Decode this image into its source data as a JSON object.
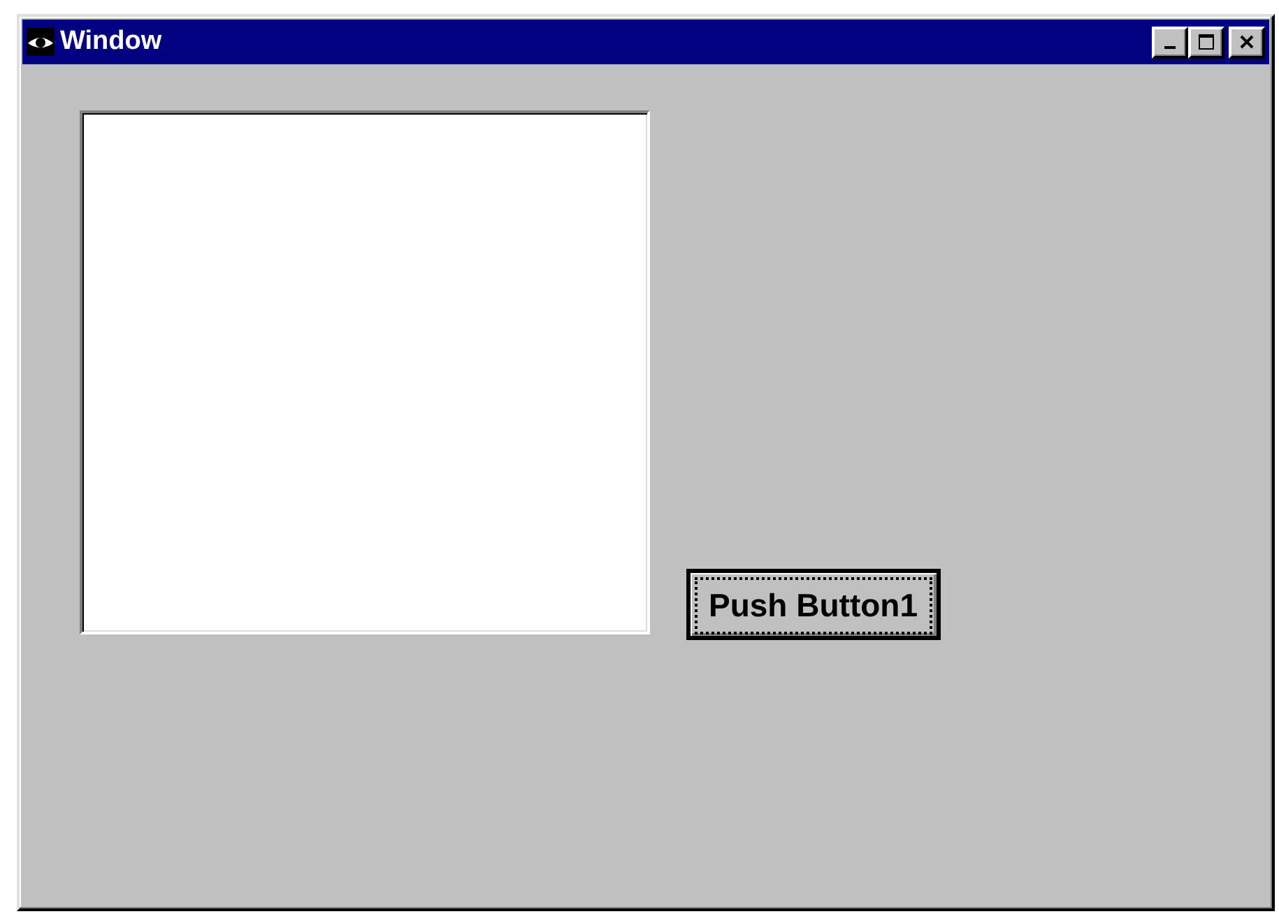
{
  "window": {
    "title": "Window"
  },
  "push_button": {
    "label": "Push Button1",
    "focused": true
  }
}
